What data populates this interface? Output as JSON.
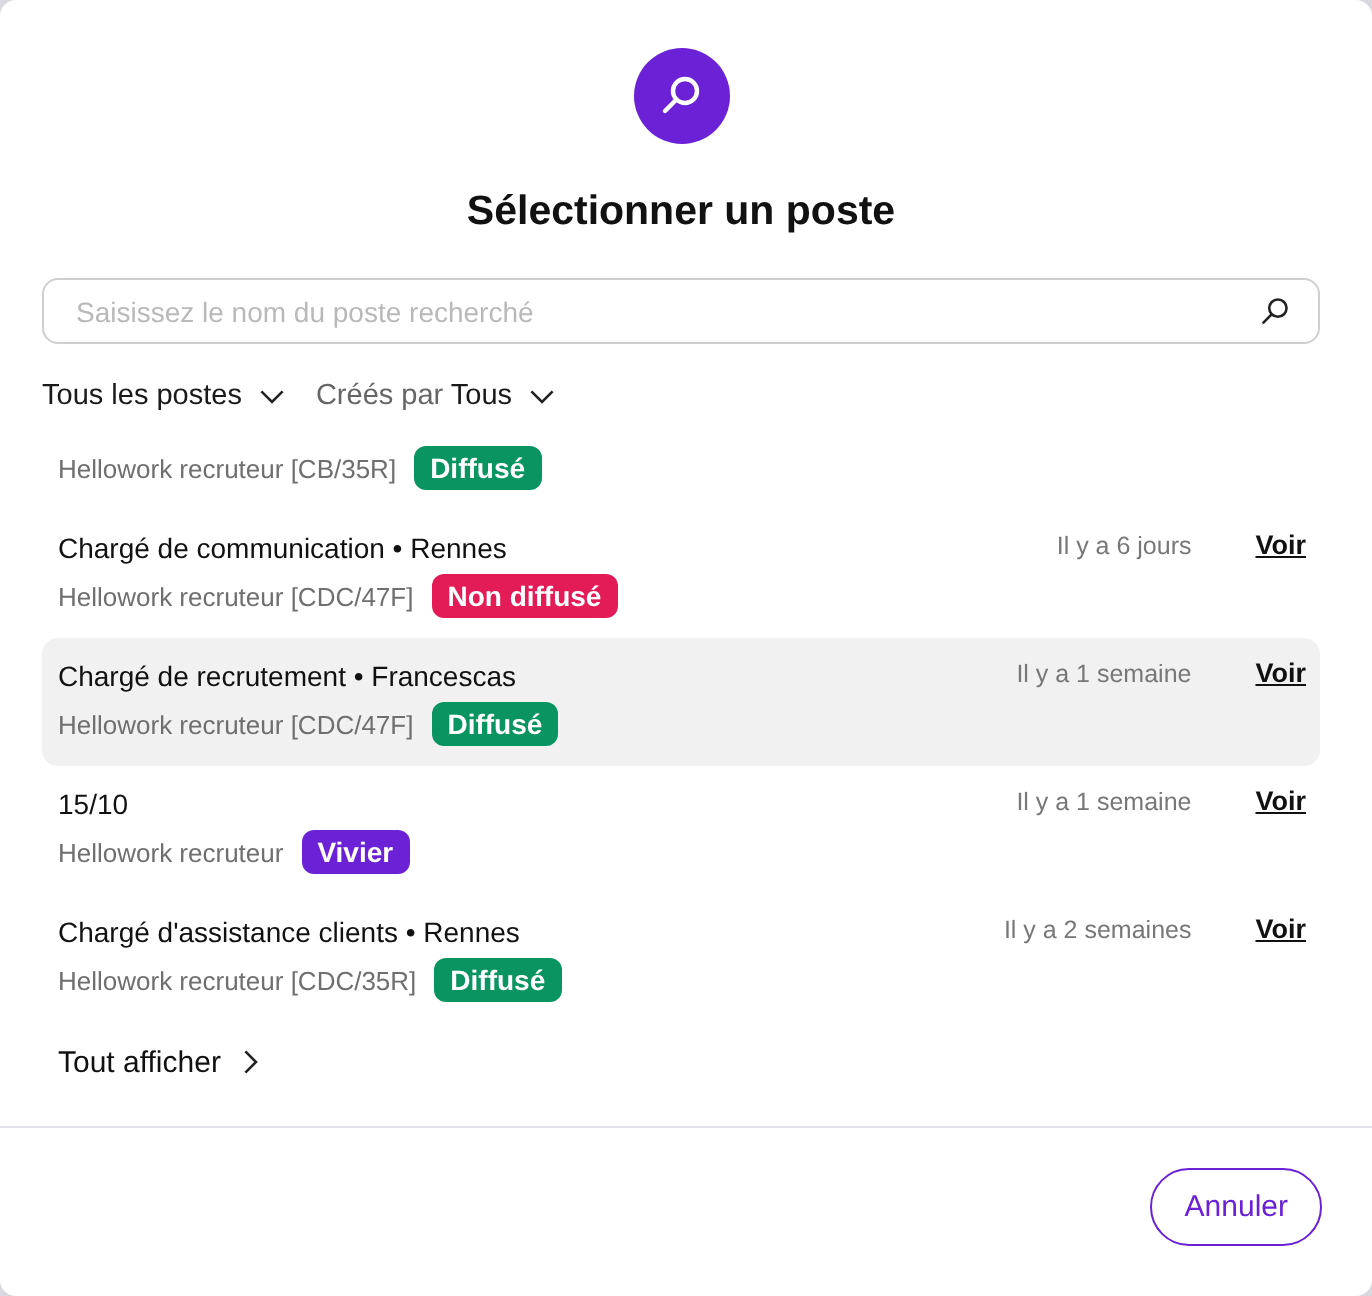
{
  "dialog": {
    "title": "Sélectionner un poste"
  },
  "search": {
    "placeholder": "Saisissez le nom du poste recherché"
  },
  "filters": [
    {
      "kind": "plain",
      "label": "Tous les postes"
    },
    {
      "kind": "prefixed",
      "prefix": "Créés par",
      "label": "Tous"
    }
  ],
  "jobs": [
    {
      "subtitle": "Hellowork recruteur [CB/35R]",
      "status": {
        "label": "Diffusé",
        "color": "#0a9461"
      },
      "selected": false
    },
    {
      "title": "Chargé de communication • Rennes",
      "date": "Il y a 6 jours",
      "action": "Voir",
      "subtitle": "Hellowork recruteur [CDC/47F]",
      "status": {
        "label": "Non diffusé",
        "color": "#e31c58"
      },
      "selected": false
    },
    {
      "title": "Chargé de recrutement • Francescas",
      "date": "Il y a 1 semaine",
      "action": "Voir",
      "subtitle": "Hellowork recruteur [CDC/47F]",
      "status": {
        "label": "Diffusé",
        "color": "#0a9461"
      },
      "selected": true
    },
    {
      "title": "15/10",
      "date": "Il y a 1 semaine",
      "action": "Voir",
      "subtitle": "Hellowork recruteur",
      "status": {
        "label": "Vivier",
        "color": "#6b22d6"
      },
      "selected": false
    },
    {
      "title": "Chargé d'assistance clients • Rennes",
      "date": "Il y a 2 semaines",
      "action": "Voir",
      "subtitle": "Hellowork recruteur [CDC/35R]",
      "status": {
        "label": "Diffusé",
        "color": "#0a9461"
      },
      "selected": false
    }
  ],
  "show_all": "Tout afficher",
  "buttons": [
    {
      "label": "Annuler"
    }
  ]
}
